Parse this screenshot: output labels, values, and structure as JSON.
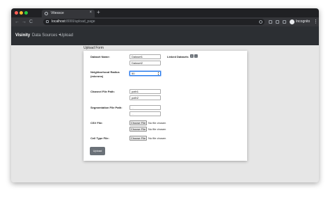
{
  "browser": {
    "tab_title": "Vitessce",
    "tab_close": "×",
    "new_tab": "+",
    "nav_back": "←",
    "nav_forward": "→",
    "nav_reload": "C",
    "url_host": "localhost",
    "url_path": ":8000/upload_page",
    "incognito_label": "Incognito",
    "menu": "⋮",
    "traffic_colors": [
      "#ff5f57",
      "#febc2e",
      "#28c840"
    ]
  },
  "app_nav": {
    "brand": "Visinity",
    "links": [
      "Data Sources",
      "Upload"
    ]
  },
  "form": {
    "section_title": "Upload Form",
    "dataset_name_label": "Dataset Name:",
    "dataset_name_values": [
      "Dataset1",
      "Dataset2"
    ],
    "linked_datasets_label": "Linked Datasets",
    "linked_buttons": [
      "+",
      "-"
    ],
    "radius_label_1": "Neighborhood Radius",
    "radius_label_2": "(microns)",
    "radius_value": "50",
    "channel_label": "Channel File Path:",
    "channel_values": [
      "path1",
      "path2"
    ],
    "seg_label": "Segmentation File Path:",
    "seg_placeholders": [
      "...",
      "..."
    ],
    "csv_label": "CSV File:",
    "cell_type_label": "Cell Type File:",
    "choose_file": "Choose File",
    "no_file": "No file chosen",
    "submit_label": "Upload"
  }
}
